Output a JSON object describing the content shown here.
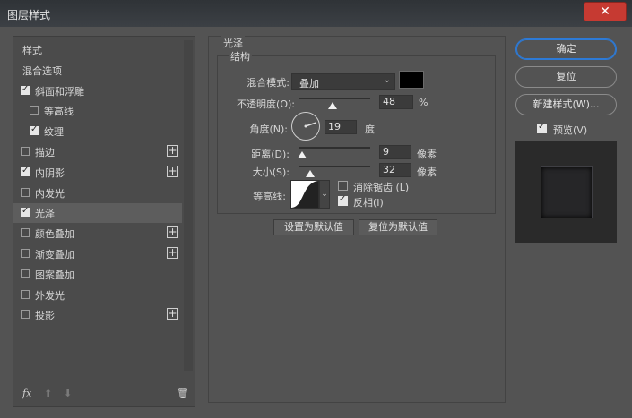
{
  "window": {
    "title": "图层样式",
    "close_label": "✕"
  },
  "left_list": {
    "items": [
      {
        "label": "样式",
        "checkbox": false,
        "checked": false,
        "plus": false,
        "indent": 0,
        "highlight": false
      },
      {
        "label": "混合选项",
        "checkbox": false,
        "checked": false,
        "plus": false,
        "indent": 0,
        "highlight": false
      },
      {
        "label": "斜面和浮雕",
        "checkbox": true,
        "checked": true,
        "plus": false,
        "indent": 0,
        "highlight": false
      },
      {
        "label": "等高线",
        "checkbox": true,
        "checked": false,
        "plus": false,
        "indent": 1,
        "highlight": false
      },
      {
        "label": "纹理",
        "checkbox": true,
        "checked": true,
        "plus": false,
        "indent": 1,
        "highlight": false
      },
      {
        "label": "描边",
        "checkbox": true,
        "checked": false,
        "plus": true,
        "indent": 0,
        "highlight": false
      },
      {
        "label": "内阴影",
        "checkbox": true,
        "checked": true,
        "plus": true,
        "indent": 0,
        "highlight": false
      },
      {
        "label": "内发光",
        "checkbox": true,
        "checked": false,
        "plus": false,
        "indent": 0,
        "highlight": false
      },
      {
        "label": "光泽",
        "checkbox": true,
        "checked": true,
        "plus": false,
        "indent": 0,
        "highlight": true
      },
      {
        "label": "颜色叠加",
        "checkbox": true,
        "checked": false,
        "plus": true,
        "indent": 0,
        "highlight": false
      },
      {
        "label": "渐变叠加",
        "checkbox": true,
        "checked": false,
        "plus": true,
        "indent": 0,
        "highlight": false
      },
      {
        "label": "图案叠加",
        "checkbox": true,
        "checked": false,
        "plus": false,
        "indent": 0,
        "highlight": false
      },
      {
        "label": "外发光",
        "checkbox": true,
        "checked": false,
        "plus": false,
        "indent": 0,
        "highlight": false
      },
      {
        "label": "投影",
        "checkbox": true,
        "checked": false,
        "plus": true,
        "indent": 0,
        "highlight": false
      }
    ],
    "plus_label": "+",
    "bottom": {
      "fx_label": "fx",
      "up_label": "⬆",
      "down_label": "⬇",
      "trash_label": "🗑"
    }
  },
  "satin": {
    "section_title": "光泽",
    "group_title": "结构",
    "blend_mode_label": "混合模式:",
    "blend_mode_value": "叠加",
    "blend_color": "#000000",
    "opacity_label": "不透明度(O):",
    "opacity_value": "48",
    "opacity_unit": "%",
    "opacity_level": 48,
    "angle_label": "角度(N):",
    "angle_value": "19",
    "angle_unit": "度",
    "distance_label": "距离(D):",
    "distance_value": "9",
    "distance_unit": "像素",
    "size_label": "大小(S):",
    "size_value": "32",
    "size_unit": "像素",
    "contour_label": "等高线:",
    "antialias_label": "消除锯齿 (L)",
    "antialias_checked": false,
    "invert_label": "反相(I)",
    "invert_checked": true,
    "make_default_label": "设置为默认值",
    "reset_default_label": "复位为默认值"
  },
  "right": {
    "ok_label": "确定",
    "reset_label": "复位",
    "new_style_label": "新建样式(W)...",
    "preview_label": "预览(V)",
    "preview_checked": true
  },
  "colors": {
    "accent": "#2d7ad6",
    "panel": "#535353",
    "highlight": "#5d5d5d"
  }
}
